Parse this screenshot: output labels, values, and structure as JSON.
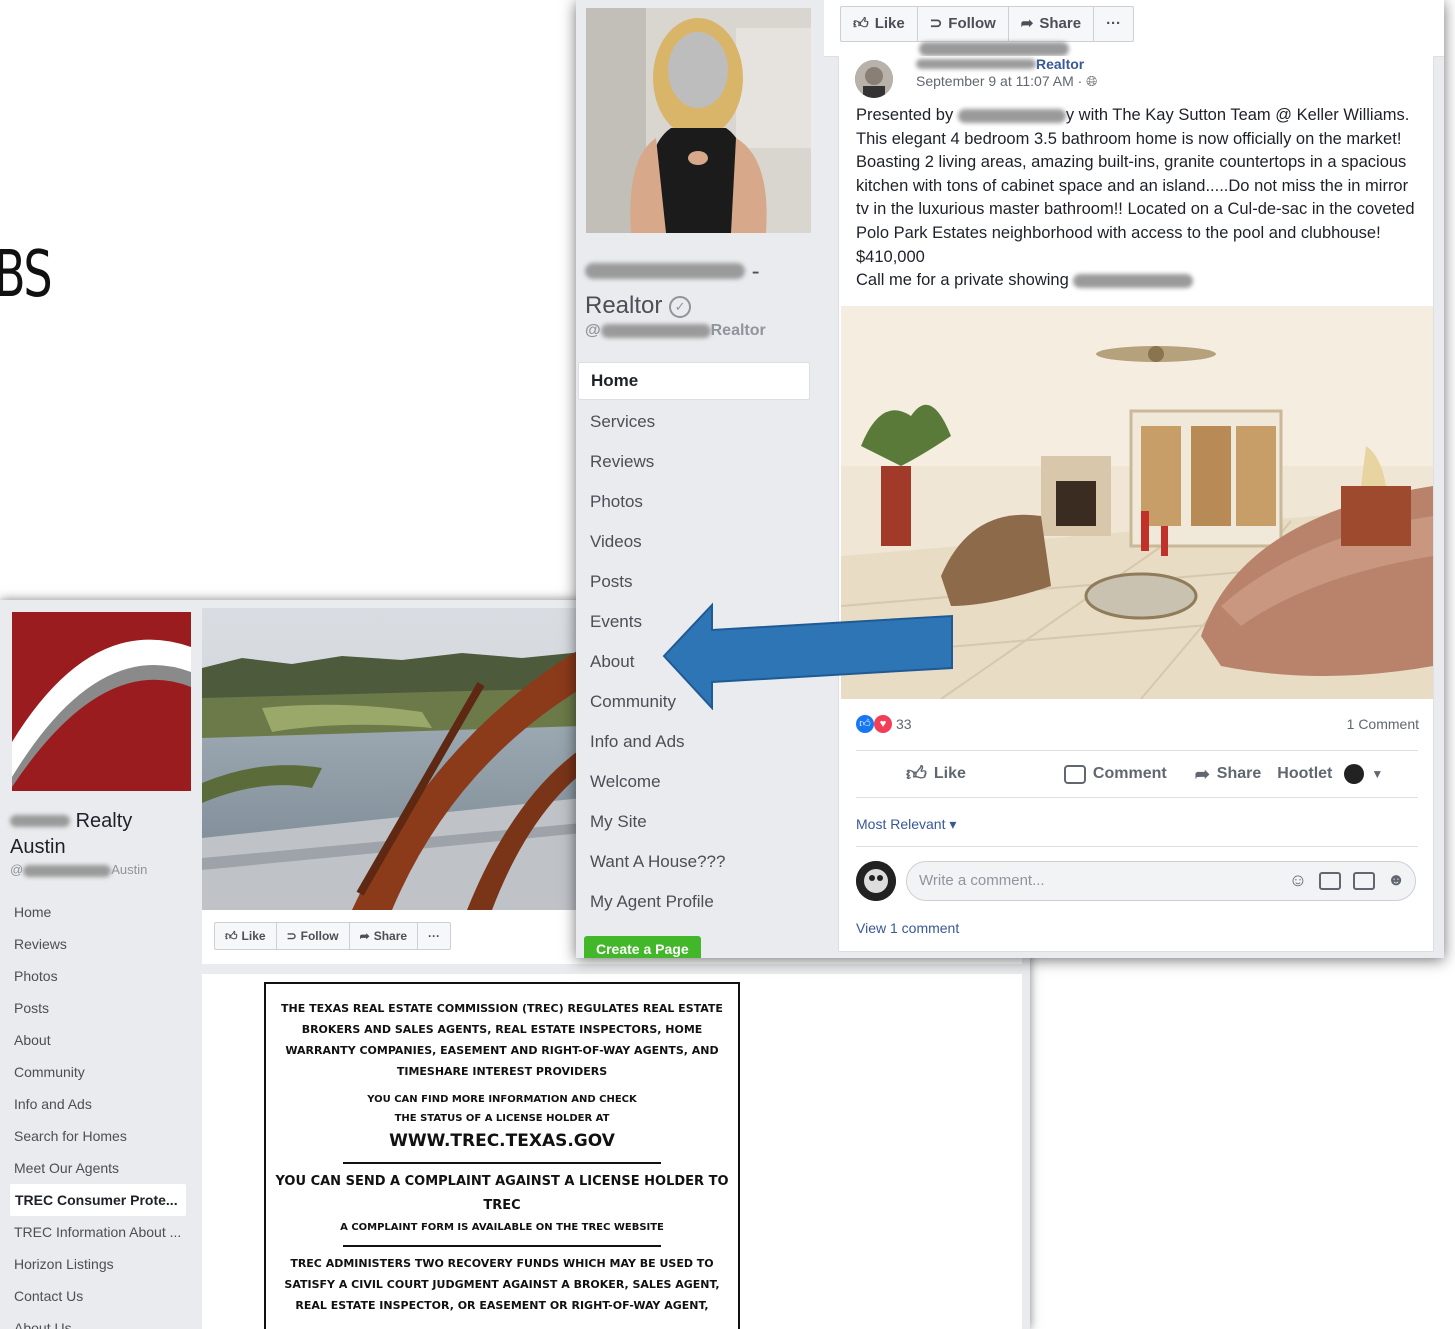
{
  "slide": {
    "fragment": "BS"
  },
  "back": {
    "page_name_line1": "Realty",
    "page_name_line2": "Austin",
    "page_handle": "Austin",
    "nav": [
      "Home",
      "Reviews",
      "Photos",
      "Posts",
      "About",
      "Community",
      "Info and Ads",
      "Search for Homes",
      "Meet Our Agents",
      "TREC Consumer Prote...",
      "TREC Information About ...",
      "Horizon Listings",
      "Contact Us",
      "About Us"
    ],
    "active_nav": "TREC Consumer Prote...",
    "buttons": {
      "like": "Like",
      "follow": "Follow",
      "share": "Share",
      "more": "···"
    },
    "trec_notice": {
      "para1": "THE TEXAS REAL ESTATE COMMISSION (TREC) REGULATES REAL ESTATE BROKERS AND SALES AGENTS, REAL ESTATE INSPECTORS, HOME WARRANTY COMPANIES, EASEMENT AND RIGHT-OF-WAY AGENTS, AND TIMESHARE INTEREST PROVIDERS",
      "para2": "YOU CAN FIND MORE INFORMATION AND CHECK THE STATUS OF A LICENSE HOLDER AT",
      "url": "WWW.TREC.TEXAS.GOV",
      "para3": "YOU CAN SEND A COMPLAINT AGAINST A LICENSE HOLDER TO TREC",
      "para4": "A COMPLAINT FORM IS AVAILABLE ON THE TREC WEBSITE",
      "para5": "TREC ADMINISTERS TWO RECOVERY FUNDS WHICH MAY BE USED TO SATISFY A CIVIL COURT JUDGMENT AGAINST A BROKER, SALES AGENT, REAL ESTATE INSPECTOR, OR EASEMENT OR RIGHT-OF-WAY AGENT,"
    }
  },
  "front": {
    "page_name_suffix": "-",
    "page_name_line2": "Realtor",
    "handle_prefix": "@",
    "handle_suffix": "Realtor",
    "nav": [
      "Home",
      "Services",
      "Reviews",
      "Photos",
      "Videos",
      "Posts",
      "Events",
      "About",
      "Community",
      "Info and Ads",
      "Welcome",
      "My Site",
      "Want A House???",
      "My Agent Profile"
    ],
    "active_nav": "Home",
    "create_page": "Create a Page",
    "buttons": {
      "like": "Like",
      "follow": "Follow",
      "share": "Share",
      "more": "···"
    },
    "post": {
      "author_suffix": "Realtor",
      "date": "September 9 at 11:07 AM · ",
      "text_prefix": "Presented by",
      "text_main": "y with The Kay Sutton Team @ Keller Williams. This elegant 4 bedroom 3.5 bathroom home is now officially on the market! Boasting 2 living areas, amazing built-ins, granite countertops in a spacious kitchen with tons of cabinet space and an island.....Do not miss the in mirror tv in the luxurious master bathroom!! Located on a Cul-de-sac in the coveted Polo Park Estates neighborhood with access to the pool and clubhouse! $410,000",
      "text_last": "Call me for a private showing",
      "reaction_count": "33",
      "comment_count": "1 Comment",
      "actions": {
        "like": "Like",
        "comment": "Comment",
        "share": "Share",
        "hootlet": "Hootlet"
      },
      "most_relevant": "Most Relevant ▾",
      "comment_placeholder": "Write a comment...",
      "view_comments": "View 1 comment"
    }
  },
  "colors": {
    "fb_blue": "#385898",
    "arrow_blue": "#2e75b6",
    "green": "#42b72a",
    "logo_red": "#9b1c1f"
  }
}
